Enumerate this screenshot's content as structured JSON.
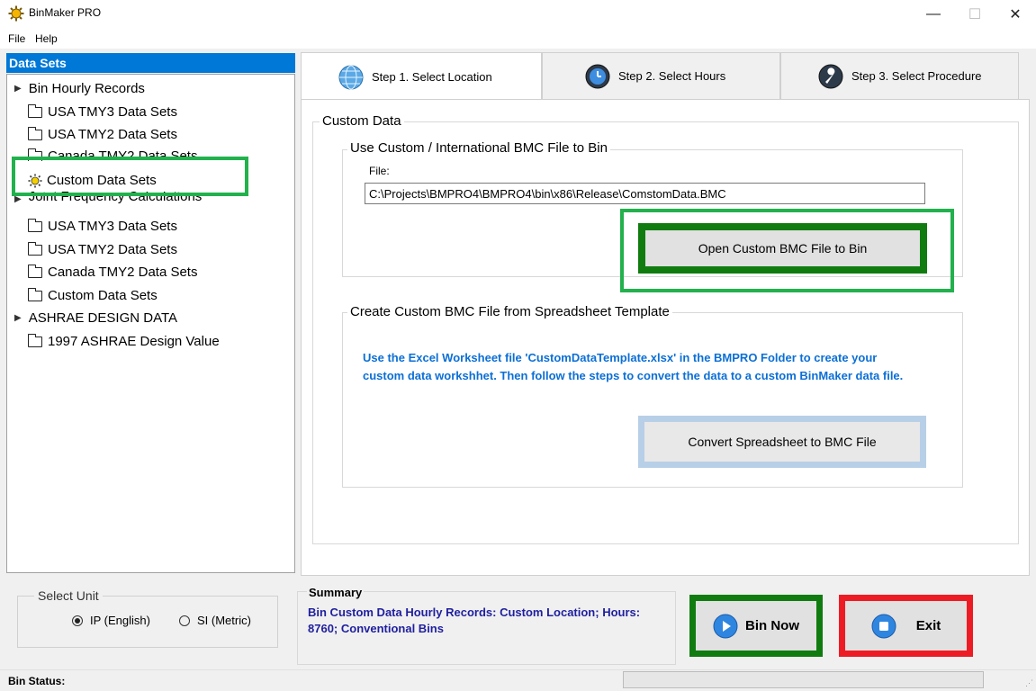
{
  "window": {
    "title": "BinMaker PRO",
    "minimize": "—",
    "maximize": "☐",
    "close": "✕"
  },
  "menu": {
    "file": "File",
    "help": "Help"
  },
  "datasets": {
    "header": "Data Sets",
    "groups": [
      {
        "label": "Bin Hourly Records",
        "items": [
          "USA TMY3 Data Sets",
          "USA TMY2 Data Sets",
          "Canada TMY2 Data Sets",
          "Custom Data Sets"
        ]
      },
      {
        "label": "Joint Frequency Calculations",
        "items": [
          "USA TMY3 Data Sets",
          "USA TMY2 Data Sets",
          "Canada TMY2 Data Sets",
          "Custom Data Sets"
        ]
      },
      {
        "label": "ASHRAE DESIGN DATA",
        "items": [
          "1997 ASHRAE Design Value"
        ]
      }
    ],
    "selected": "Custom Data Sets"
  },
  "tabs": [
    "Step 1.  Select Location",
    "Step 2.  Select Hours",
    "Step 3.  Select Procedure"
  ],
  "custom": {
    "group_title": "Custom Data",
    "bmc_group_title": "Use Custom / International BMC File to Bin",
    "file_label": "File:",
    "file_value": "C:\\Projects\\BMPRO4\\BMPRO4\\bin\\x86\\Release\\ComstomData.BMC",
    "open_button": "Open Custom BMC File to Bin",
    "sheet_group_title": "Create  Custom BMC File from Spreadsheet Template",
    "instructions": "Use the Excel Worksheet file 'CustomDataTemplate.xlsx' in the BMPRO Folder to create your custom data workshhet.  Then follow the steps to convert the data to a custom BinMaker data file.",
    "convert_button": "Convert Spreadsheet to BMC File"
  },
  "unit": {
    "title": "Select Unit",
    "ip": "IP (English)",
    "si": "SI (Metric)",
    "selected": "ip"
  },
  "summary": {
    "title": "Summary",
    "text": "Bin Custom Data Hourly Records: Custom Location; Hours: 8760; Conventional Bins"
  },
  "actions": {
    "bin_now": "Bin Now",
    "exit": "Exit"
  },
  "status": {
    "label": "Bin Status:"
  },
  "colors": {
    "accent": "#0078d7",
    "highlight_green": "#22b14c",
    "dark_green": "#107c10",
    "red": "#ed1c24",
    "light_blue": "#b8cfe8",
    "summary_text": "#1f1f9f",
    "instruction_text": "#0b6fd6"
  }
}
